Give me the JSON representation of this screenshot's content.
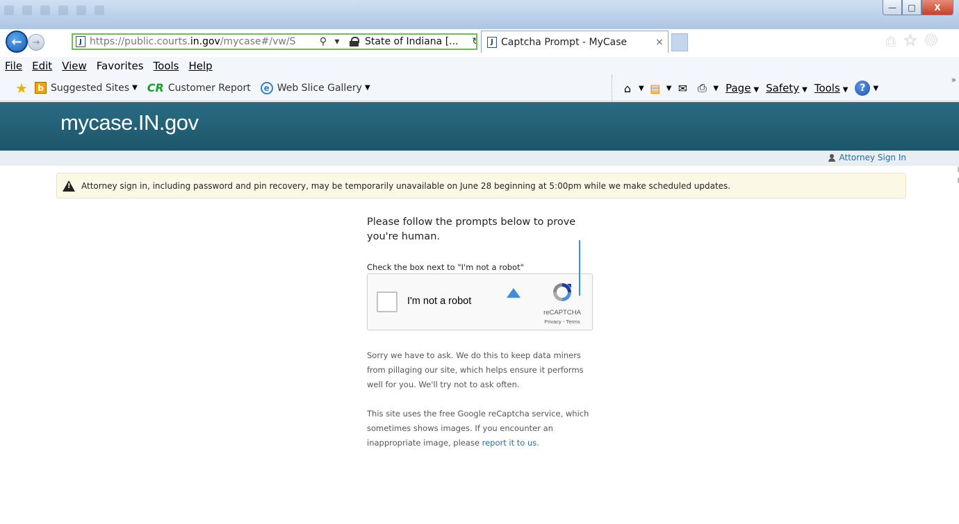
{
  "browser": {
    "url_prefix": "https://public.courts.",
    "url_domain": "in.gov",
    "url_path": "/mycase#/vw/S",
    "identity": "State of Indiana [...",
    "tab_title": "Captcha Prompt - MyCase",
    "tab_close": "×",
    "window_buttons": {
      "minimize": "—",
      "maximize": "□",
      "close": "X"
    },
    "menu": [
      "File",
      "Edit",
      "View",
      "Favorites",
      "Tools",
      "Help"
    ],
    "favorites": {
      "suggested_sites": "Suggested Sites",
      "customer_report": "Customer Report",
      "customer_report_icon": "CR",
      "web_slice_gallery": "Web Slice Gallery"
    },
    "commands": {
      "page": "Page",
      "safety": "Safety",
      "tools": "Tools"
    }
  },
  "site": {
    "logo": "mycase.IN.gov",
    "attorney_sign_in": "Attorney Sign In",
    "alert": "Attorney sign in, including password and pin recovery, may be temporarily unavailable on June 28 beginning at 5:00pm while we make scheduled updates."
  },
  "captcha": {
    "title": "Please follow the prompts below to prove you're human.",
    "instruction": "Check the box next to \"I'm not a robot\"",
    "checkbox_label": "I'm not a robot",
    "checked": false,
    "brand": "reCAPTCHA",
    "privacy": "Privacy",
    "terms": "Terms",
    "links_separator": " - "
  },
  "explanation": {
    "paragraph1": "Sorry we have to ask. We do this to keep data miners from pillaging our site, which helps ensure it performs well for you. We'll try not to ask often.",
    "paragraph2_text": "This site uses the free Google reCaptcha service, which sometimes shows images. If you encounter an inappropriate image, please ",
    "report_link": "report it to us",
    "paragraph2_end": "."
  },
  "colors": {
    "header_bg": "#1d566a",
    "link": "#2a6c9c",
    "alert_bg": "#fcf8e6",
    "address_border": "#6bbf4f"
  }
}
